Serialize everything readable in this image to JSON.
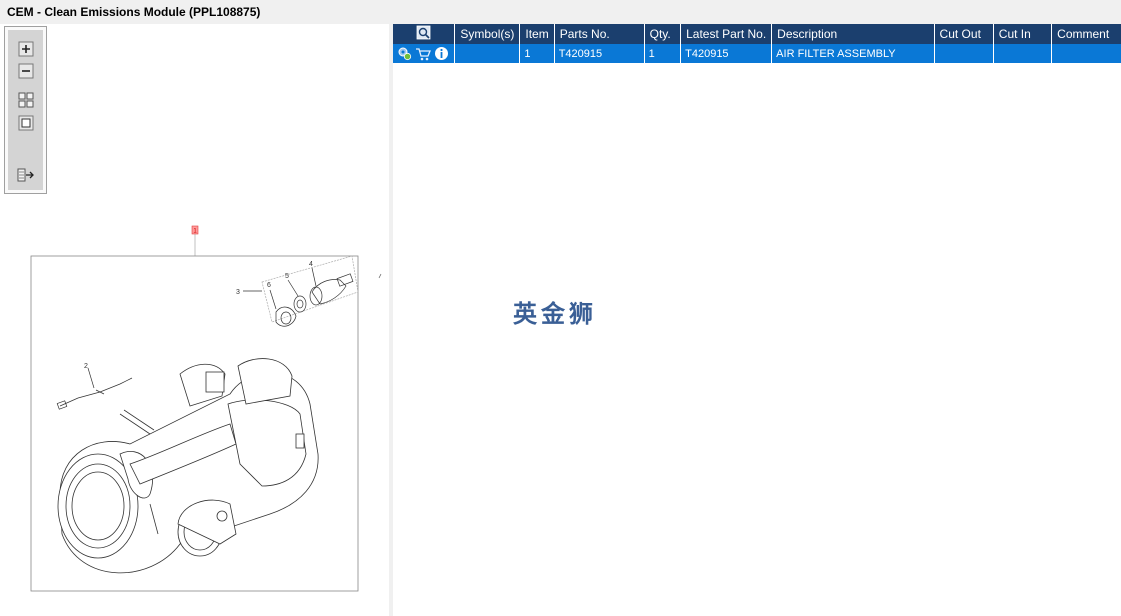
{
  "window": {
    "title": "CEM - Clean Emissions Module (PPL108875)"
  },
  "toolbar": {
    "buttons": [
      {
        "name": "zoom-in-icon"
      },
      {
        "name": "zoom-out-icon"
      },
      {
        "name": "fit-all-icon"
      },
      {
        "name": "actual-size-icon"
      },
      {
        "name": "export-icon"
      }
    ]
  },
  "drawing": {
    "hotspot_label": "1",
    "callouts": {
      "c2": "2",
      "c3": "3",
      "c4": "4",
      "c5": "5",
      "c6": "6"
    }
  },
  "watermark": "英金狮",
  "table": {
    "headers": [
      "",
      "Symbol(s)",
      "Item",
      "Parts No.",
      "Qty.",
      "Latest Part No.",
      "Description",
      "Cut Out",
      "Cut In",
      "Comment"
    ],
    "rows": [
      {
        "icons": [
          "settings-gear-icon",
          "cart-icon",
          "info-icon"
        ],
        "symbols": "",
        "item": "1",
        "part_no": "T420915",
        "qty": "1",
        "latest_part_no": "T420915",
        "description": "AIR FILTER ASSEMBLY",
        "cut_out": "",
        "cut_in": "",
        "comment": ""
      }
    ]
  },
  "colors": {
    "header_bg": "#1b3f6e",
    "row_selected_bg": "#0a78d6",
    "watermark": "#3a5f96",
    "hotspot": "#e04040"
  }
}
